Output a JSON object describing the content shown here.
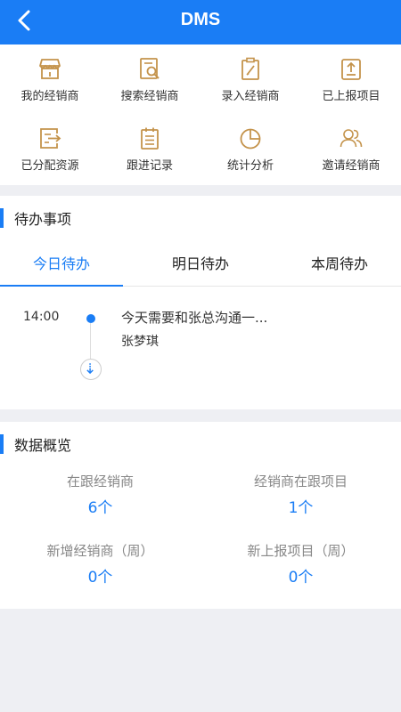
{
  "header": {
    "title": "DMS",
    "back_icon": "chevron-left-icon"
  },
  "shortcuts": [
    {
      "label": "我的经销商",
      "icon": "store-icon"
    },
    {
      "label": "搜索经销商",
      "icon": "search-document-icon"
    },
    {
      "label": "录入经销商",
      "icon": "clipboard-edit-icon"
    },
    {
      "label": "已上报项目",
      "icon": "upload-clipboard-icon"
    },
    {
      "label": "已分配资源",
      "icon": "export-document-icon"
    },
    {
      "label": "跟进记录",
      "icon": "notepad-icon"
    },
    {
      "label": "统计分析",
      "icon": "pie-chart-icon"
    },
    {
      "label": "邀请经销商",
      "icon": "users-icon"
    }
  ],
  "todo": {
    "title": "待办事项",
    "tabs": [
      "今日待办",
      "明日待办",
      "本周待办"
    ],
    "active_tab": 0,
    "items": [
      {
        "time": "14:00",
        "text": "今天需要和张总沟通一...",
        "person": "张梦琪"
      }
    ]
  },
  "overview": {
    "title": "数据概览",
    "stats": [
      {
        "label": "在跟经销商",
        "value": "6个"
      },
      {
        "label": "经销商在跟项目",
        "value": "1个"
      },
      {
        "label": "新增经销商（周）",
        "value": "0个"
      },
      {
        "label": "新上报项目（周）",
        "value": "0个"
      }
    ]
  },
  "colors": {
    "primary": "#1a7df5",
    "icon_gold": "#c4934b",
    "background": "#eeeff3"
  }
}
